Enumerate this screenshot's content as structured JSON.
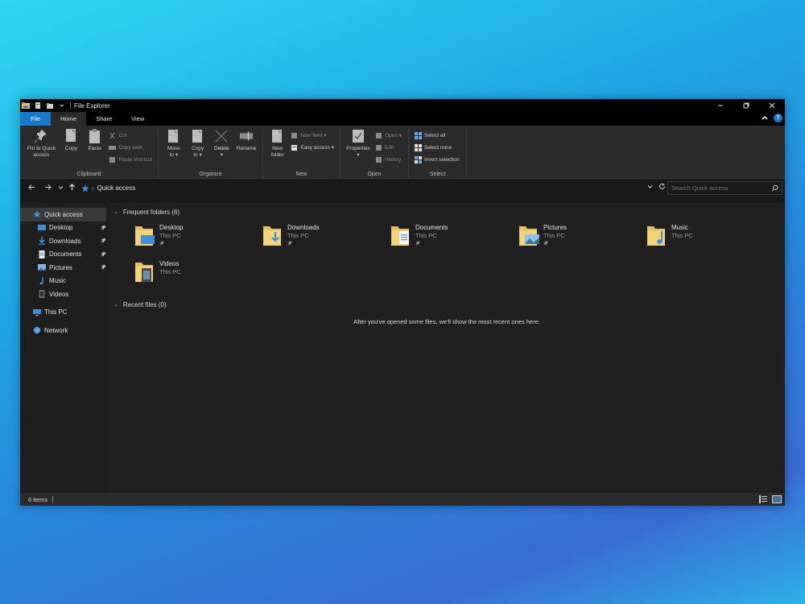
{
  "window": {
    "title": "File Explorer"
  },
  "tabs": [
    "File",
    "Home",
    "Share",
    "View"
  ],
  "ribbon": {
    "clipboard": {
      "label": "Clipboard",
      "pin_line1": "Pin to Quick",
      "pin_line2": "access",
      "copy": "Copy",
      "paste": "Paste",
      "cut": "Cut",
      "copy_path": "Copy path",
      "paste_shortcut": "Paste shortcut"
    },
    "organize": {
      "label": "Organize",
      "move_line1": "Move",
      "move_line2": "to ▾",
      "copy_line1": "Copy",
      "copy_line2": "to ▾",
      "delete": "Delete",
      "delete_arrow": "▾",
      "rename": "Rename"
    },
    "new": {
      "label": "New",
      "new_folder_line1": "New",
      "new_folder_line2": "folder",
      "new_item": "New item ▾",
      "easy_access": "Easy access ▾"
    },
    "open": {
      "label": "Open",
      "properties": "Properties",
      "properties_arrow": "▾",
      "open": "Open ▾",
      "edit": "Edit",
      "history": "History"
    },
    "select": {
      "label": "Select",
      "select_all": "Select all",
      "select_none": "Select none",
      "invert": "Invert selection"
    }
  },
  "address": {
    "path": "Quick access",
    "search_placeholder": "Search Quick access"
  },
  "nav": {
    "quick_access": "Quick access",
    "items": [
      {
        "label": "Desktop"
      },
      {
        "label": "Downloads"
      },
      {
        "label": "Documents"
      },
      {
        "label": "Pictures"
      },
      {
        "label": "Music"
      },
      {
        "label": "Videos"
      }
    ],
    "this_pc": "This PC",
    "network": "Network"
  },
  "content": {
    "frequent_title": "Frequent folders (6)",
    "folders": [
      {
        "name": "Desktop",
        "location": "This PC"
      },
      {
        "name": "Downloads",
        "location": "This PC"
      },
      {
        "name": "Documents",
        "location": "This PC"
      },
      {
        "name": "Pictures",
        "location": "This PC"
      },
      {
        "name": "Music",
        "location": "This PC"
      },
      {
        "name": "Videos",
        "location": "This PC"
      }
    ],
    "recent_title": "Recent files (0)",
    "empty_message": "After you've opened some files, we'll show the most recent ones here."
  },
  "status": {
    "items": "6 items"
  },
  "colors": {
    "accent": "#1979ca",
    "folder": "#e8c25a",
    "window_bg": "#191919",
    "ribbon_bg": "#2b2b2b"
  }
}
